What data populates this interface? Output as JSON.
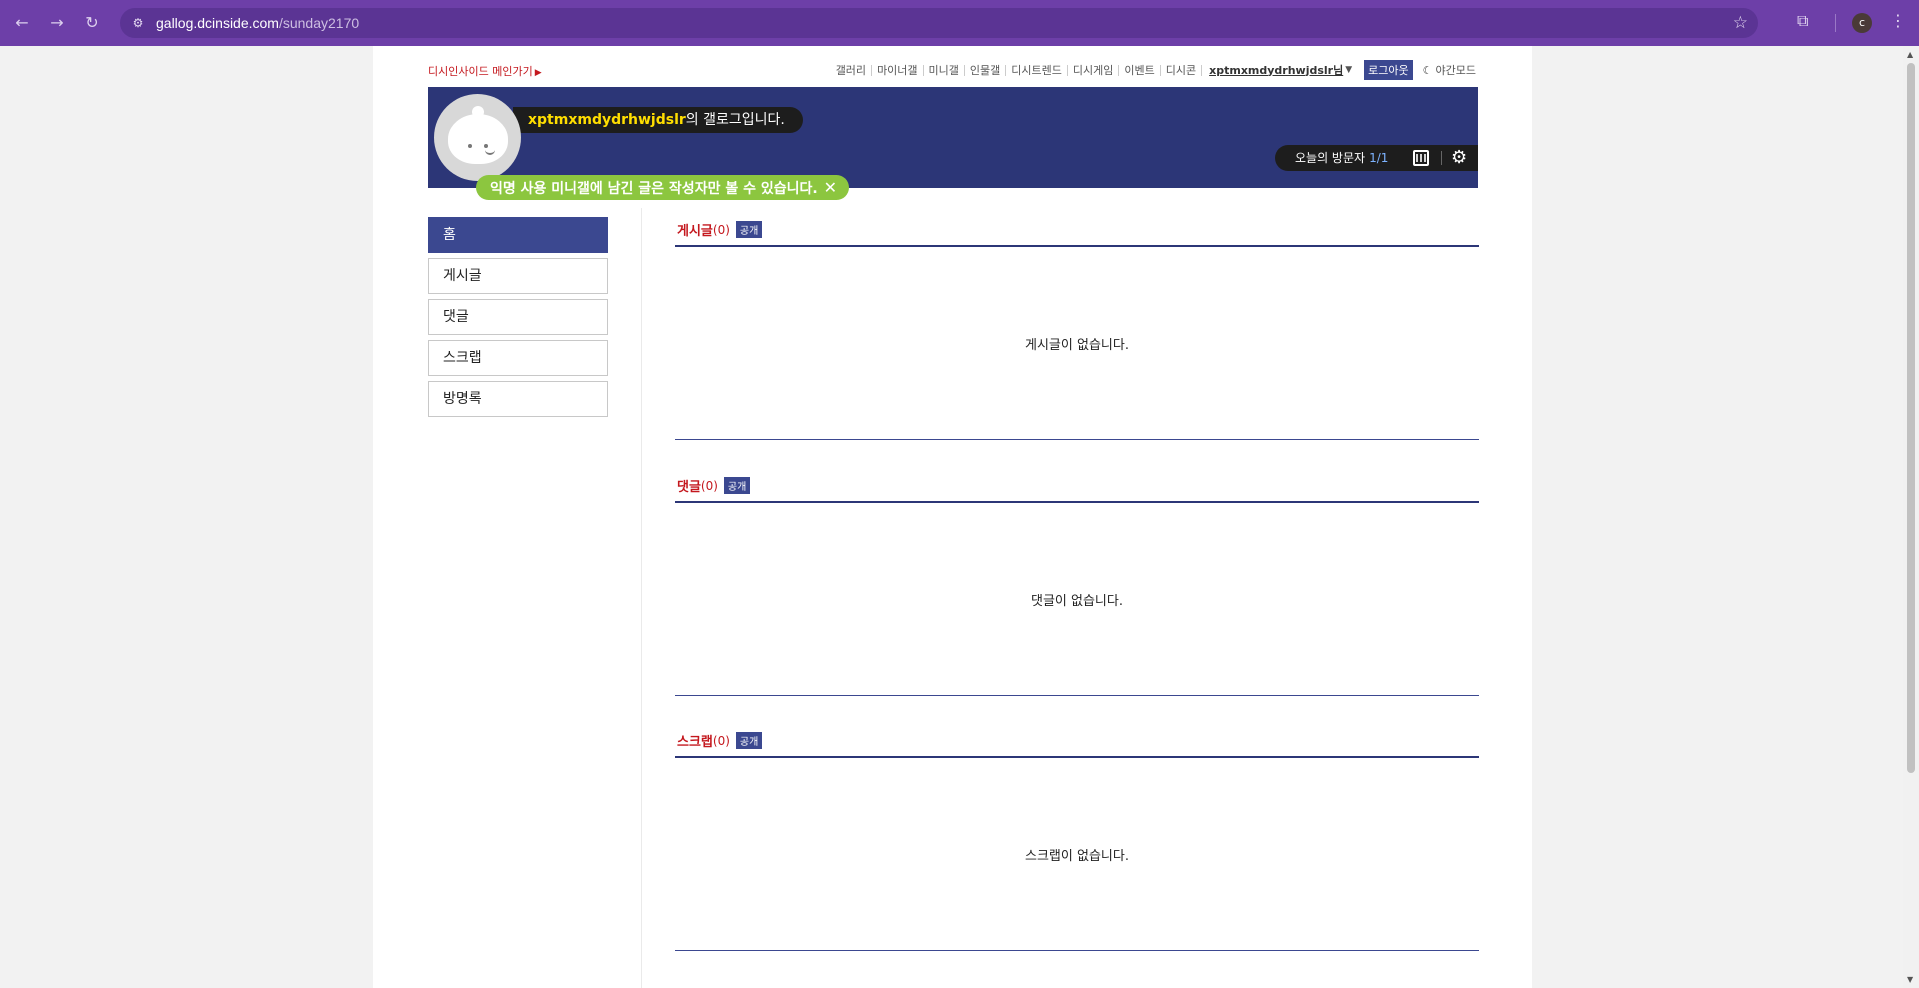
{
  "browser": {
    "url_domain": "gallog.dcinside.com",
    "url_path": "/sunday2170",
    "profile_initial": "c"
  },
  "header": {
    "main_link": "디시인사이드 메인가기",
    "nav": [
      "갤러리",
      "마이너갤",
      "미니갤",
      "인물갤",
      "디시트렌드",
      "디시게임",
      "이벤트",
      "디시콘"
    ],
    "user": "xptmxmdydrhwjdslr님",
    "logout": "로그아웃",
    "night_mode": "야간모드"
  },
  "banner": {
    "username": "xptmxmdydrhwjdslr",
    "title_suffix": "의 갤로그입니다.",
    "visitor_label": "오늘의 방문자",
    "visitor_count": "1/1",
    "notice": "익명 사용 미니갤에 남긴 글은 작성자만 볼 수 있습니다."
  },
  "sidebar": {
    "items": [
      "홈",
      "게시글",
      "댓글",
      "스크랩",
      "방명록"
    ]
  },
  "sections": [
    {
      "title": "게시글",
      "count": "(0)",
      "badge": "공개",
      "empty": "게시글이 없습니다."
    },
    {
      "title": "댓글",
      "count": "(0)",
      "badge": "공개",
      "empty": "댓글이 없습니다."
    },
    {
      "title": "스크랩",
      "count": "(0)",
      "badge": "공개",
      "empty": "스크랩이 없습니다."
    }
  ],
  "colors": {
    "chrome": "#6d3fa8",
    "banner": "#2c3677",
    "accent": "#3b4890",
    "red": "#c4181e",
    "notice": "#8cc63f"
  }
}
